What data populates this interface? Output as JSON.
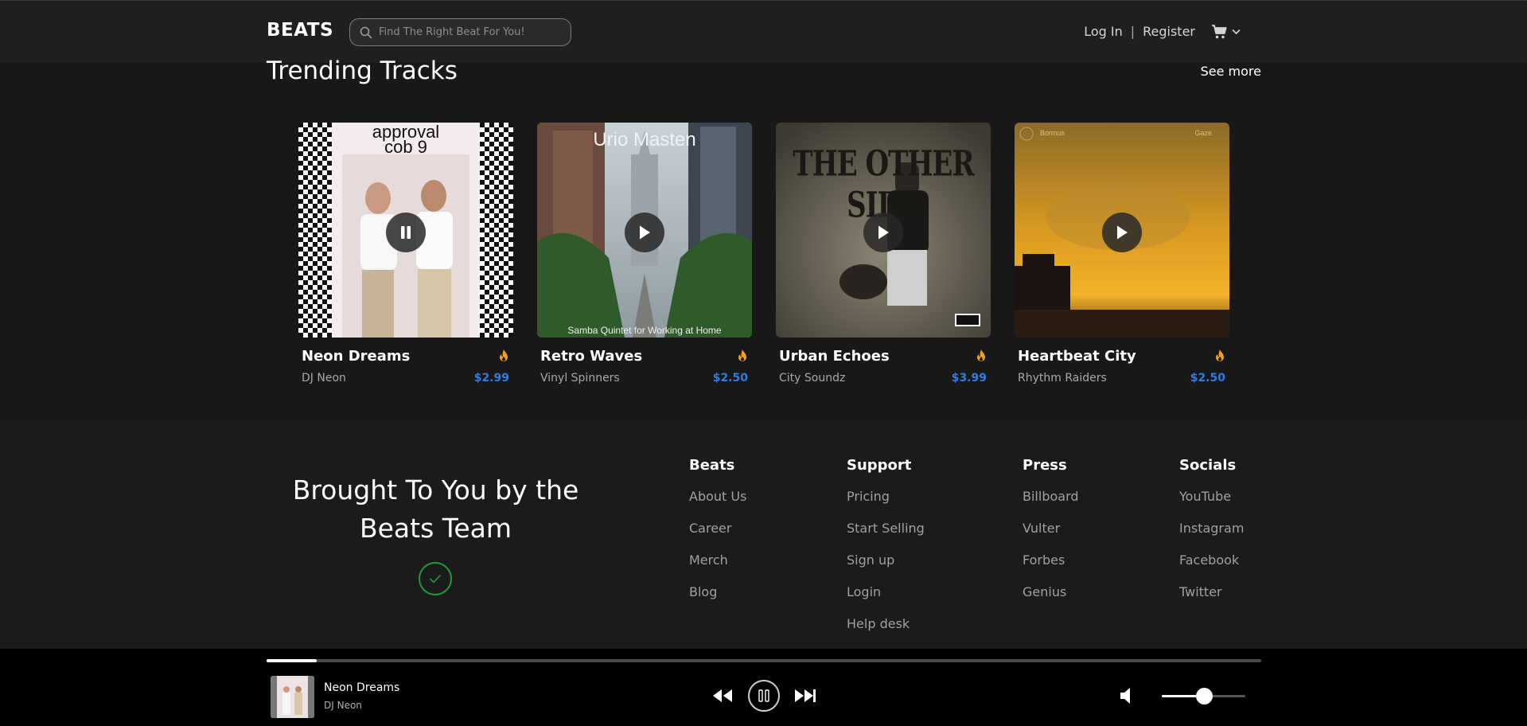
{
  "header": {
    "logo": "BEATS",
    "search_placeholder": "Find The Right Beat For You!",
    "login": "Log In",
    "separator": "|",
    "register": "Register"
  },
  "trending": {
    "title": "Trending Tracks",
    "see_more": "See more",
    "tracks": [
      {
        "title": "Neon Dreams",
        "artist": "DJ Neon",
        "price": "$2.99",
        "cover_text_top": "approval",
        "cover_text_bottom": "cob 9",
        "state": "playing"
      },
      {
        "title": "Retro Waves",
        "artist": "Vinyl Spinners",
        "price": "$2.50",
        "cover_text_top": "Urio Masten",
        "cover_caption": "Samba Quintet for Working at Home",
        "state": "paused"
      },
      {
        "title": "Urban Echoes",
        "artist": "City Soundz",
        "price": "$3.99",
        "cover_text_top": "THE OTHER SIDE",
        "state": "paused"
      },
      {
        "title": "Heartbeat City",
        "artist": "Rhythm Raiders",
        "price": "$2.50",
        "cover_label_left": "Bormus",
        "cover_label_right": "Gaze",
        "state": "paused"
      }
    ]
  },
  "footer": {
    "tagline_line1": "Brought To You by the",
    "tagline_line2": "Beats Team",
    "columns": [
      {
        "heading": "Beats",
        "links": [
          "About Us",
          "Career",
          "Merch",
          "Blog"
        ]
      },
      {
        "heading": "Support",
        "links": [
          "Pricing",
          "Start Selling",
          "Sign up",
          "Login",
          "Help desk"
        ]
      },
      {
        "heading": "Press",
        "links": [
          "Billboard",
          "Vulter",
          "Forbes",
          "Genius"
        ]
      },
      {
        "heading": "Socials",
        "links": [
          "YouTube",
          "Instagram",
          "Facebook",
          "Twitter"
        ]
      }
    ]
  },
  "player": {
    "title": "Neon Dreams",
    "artist": "DJ Neon",
    "progress": 0.05,
    "volume": 0.5,
    "state": "playing"
  },
  "colors": {
    "accent_price": "#2f7de1",
    "fire": "#f0a020",
    "check": "#1e9a3a"
  }
}
